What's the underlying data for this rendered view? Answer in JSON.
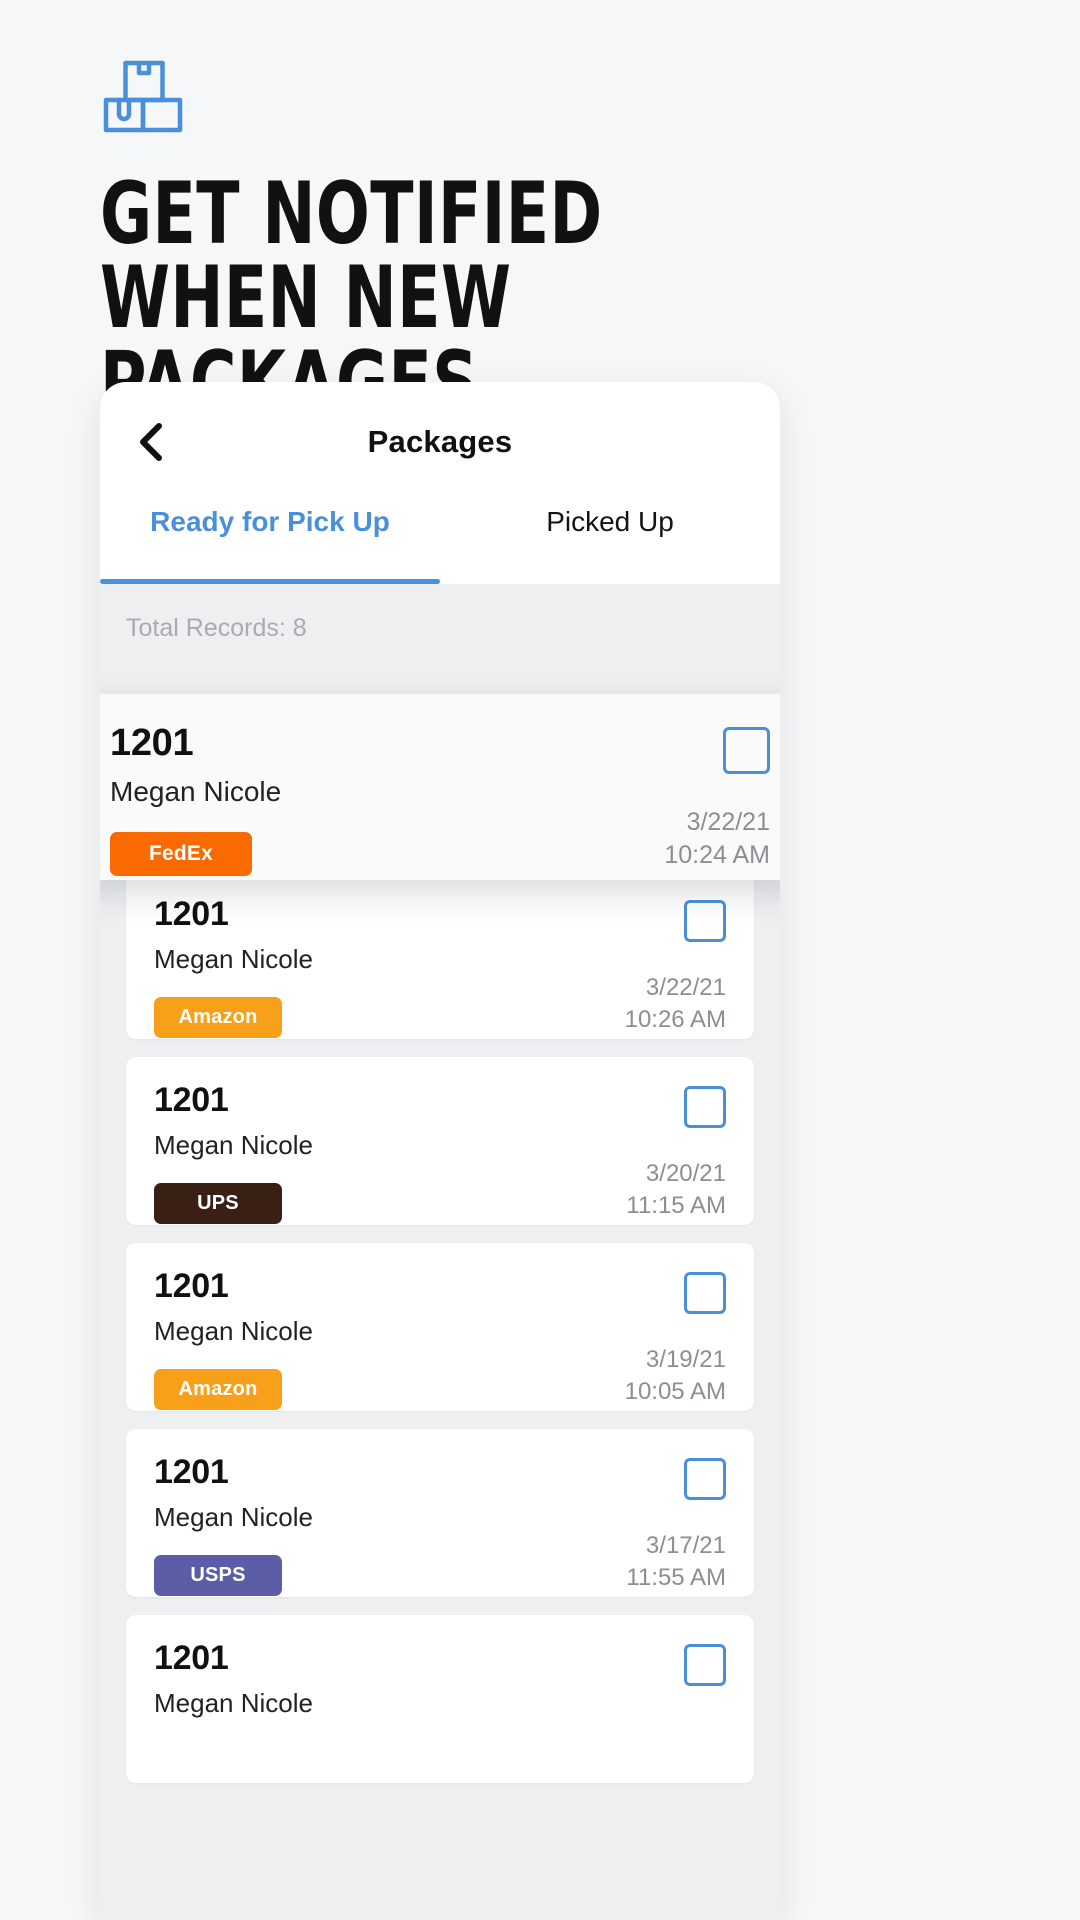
{
  "hero": {
    "icon": "packages-boxes-icon",
    "icon_color": "#4a90d9",
    "headline_line1": "GET NOTIFIED WHEN NEW",
    "headline_line2": "PACKAGES ARRIVE"
  },
  "app": {
    "nav": {
      "back_icon": "chevron-left-icon",
      "title": "Packages"
    },
    "tabs": [
      {
        "label": "Ready for Pick Up",
        "active": true
      },
      {
        "label": "Picked Up",
        "active": false
      }
    ],
    "list": {
      "total_records_label": "Total Records: 8",
      "checkbox_color": "#4a90d9",
      "featured": {
        "unit": "1201",
        "resident": "Megan Nicole",
        "carrier": "FedEx",
        "carrier_color": "#f96a00",
        "date": "3/22/21",
        "time": "10:24 AM"
      },
      "items": [
        {
          "unit": "1201",
          "resident": "Megan Nicole",
          "carrier": "Amazon",
          "carrier_color": "#f9a01b",
          "date": "3/22/21",
          "time": "10:26 AM"
        },
        {
          "unit": "1201",
          "resident": "Megan Nicole",
          "carrier": "UPS",
          "carrier_color": "#3a1f14",
          "date": "3/20/21",
          "time": "11:15 AM"
        },
        {
          "unit": "1201",
          "resident": "Megan Nicole",
          "carrier": "Amazon",
          "carrier_color": "#f9a01b",
          "date": "3/19/21",
          "time": "10:05 AM"
        },
        {
          "unit": "1201",
          "resident": "Megan Nicole",
          "carrier": "USPS",
          "carrier_color": "#5b5ea6",
          "date": "3/17/21",
          "time": "11:55 AM"
        },
        {
          "unit": "1201",
          "resident": "Megan Nicole",
          "carrier": "",
          "carrier_color": "#f9a01b",
          "date": "",
          "time": ""
        }
      ]
    }
  }
}
